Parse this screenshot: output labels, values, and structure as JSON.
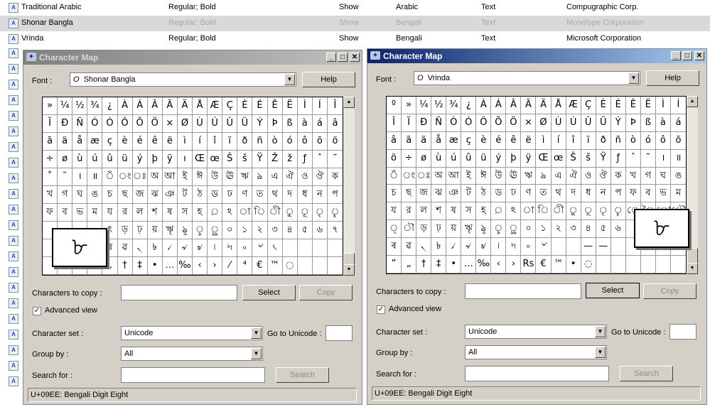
{
  "font_list": {
    "rows": [
      {
        "name": "Traditional Arabic",
        "styles": "Regular; Bold",
        "show": "Show",
        "script": "Arabic",
        "type": "Text",
        "vendor": "Compugraphic Corp."
      },
      {
        "name": "Shonar Bangla",
        "styles": "Regular; Bold",
        "show": "Show",
        "script": "Bengali",
        "type": "Text",
        "vendor": "Monotype Corporation"
      },
      {
        "name": "Vrinda",
        "styles": "Regular; Bold",
        "show": "Show",
        "script": "Bengali",
        "type": "Text",
        "vendor": "Microsoft Corporation"
      }
    ],
    "icon_glyph": "A"
  },
  "left_window": {
    "title": "Character Map",
    "font_label": "Font :",
    "font_value": "Shonar Bangla",
    "font_glyph": "O",
    "help": "Help",
    "chars_label": "Characters to copy :",
    "select": "Select",
    "copy": "Copy",
    "advanced": "Advanced view",
    "charset_label": "Character set :",
    "charset_value": "Unicode",
    "goto_label": "Go to Unicode :",
    "group_label": "Group by :",
    "group_value": "All",
    "search_label": "Search for :",
    "search_btn": "Search",
    "status": "U+09EE: Bengali Digit Eight",
    "zoom_char": "৮",
    "grid": [
      "»",
      "¼",
      "½",
      "¾",
      "¿",
      "À",
      "Á",
      "Â",
      "Ã",
      "Ä",
      "Å",
      "Æ",
      "Ç",
      "È",
      "É",
      "Ê",
      "Ë",
      "Ì",
      "Í",
      "Î",
      "Ï",
      "Ð",
      "Ñ",
      "Ò",
      "Ó",
      "Ô",
      "Õ",
      "Ö",
      "×",
      "Ø",
      "Ù",
      "Ú",
      "Û",
      "Ü",
      "Ý",
      "Þ",
      "ß",
      "à",
      "á",
      "â",
      "ã",
      "ä",
      "å",
      "æ",
      "ç",
      "è",
      "é",
      "ê",
      "ë",
      "ì",
      "í",
      "î",
      "ï",
      "ð",
      "ñ",
      "ò",
      "ó",
      "ô",
      "õ",
      "ö",
      "÷",
      "ø",
      "ù",
      "ú",
      "û",
      "ü",
      "ý",
      "þ",
      "ÿ",
      "ı",
      "Œ",
      "œ",
      "Š",
      "š",
      "Ÿ",
      "Ž",
      "ž",
      "ƒ",
      "ˆ",
      "˜",
      "˚",
      "˜",
      "।",
      "॥",
      "ঁ",
      "ং",
      "ঃ",
      "অ",
      "আ",
      "ই",
      "ঈ",
      "উ",
      "ঊ",
      "ঋ",
      "ঌ",
      "এ",
      "ঐ",
      "ও",
      "ঔ",
      "ক",
      "খ",
      "গ",
      "ঘ",
      "ঙ",
      "চ",
      "ছ",
      "জ",
      "ঝ",
      "ঞ",
      "ট",
      "ঠ",
      "ড",
      "ঢ",
      "ণ",
      "ত",
      "থ",
      "দ",
      "ধ",
      "ন",
      "প",
      "ফ",
      "ব",
      "ভ",
      "ম",
      "য",
      "র",
      "ল",
      "শ",
      "ষ",
      "স",
      "হ",
      "়",
      "ঽ",
      "া",
      "ি",
      "ী",
      "ু",
      "ূ",
      "ৃ",
      "ৄ",
      "",
      "",
      "",
      "",
      "ৎ",
      "ড়",
      "ঢ়",
      "য়",
      "ৠ",
      "ৡ",
      "ৢ",
      "ৣ",
      "০",
      "১",
      "২",
      "৩",
      "৪",
      "৫",
      "৬",
      "৭",
      "",
      "",
      "",
      "",
      "ৰ",
      "ৱ",
      "৲",
      "৳",
      "৴",
      "৵",
      "৶",
      "৷",
      "৸",
      "৹",
      "৺",
      "৻",
      "",
      "",
      "",
      "",
      "",
      "",
      "",
      "”",
      "„",
      "†",
      "‡",
      "•",
      "…",
      "‰",
      "‹",
      "›",
      "⁄",
      "⁴",
      "€",
      "™",
      "◌",
      "",
      "",
      ""
    ]
  },
  "right_window": {
    "title": "Character Map",
    "font_label": "Font :",
    "font_value": "Vrinda",
    "font_glyph": "O",
    "help": "Help",
    "chars_label": "Characters to copy :",
    "select": "Select",
    "copy": "Copy",
    "advanced": "Advanced view",
    "charset_label": "Character set :",
    "charset_value": "Unicode",
    "goto_label": "Go to Unicode :",
    "group_label": "Group by :",
    "group_value": "All",
    "search_label": "Search for :",
    "search_btn": "Search",
    "status": "U+09EE: Bengali Digit Eight",
    "zoom_char": "৮",
    "grid": [
      "º",
      "»",
      "¼",
      "½",
      "¾",
      "¿",
      "À",
      "Á",
      "Â",
      "Ã",
      "Ä",
      "Å",
      "Æ",
      "Ç",
      "È",
      "É",
      "Ê",
      "Ë",
      "Ì",
      "Í",
      "Î",
      "Ï",
      "Ð",
      "Ñ",
      "Ò",
      "Ó",
      "Ô",
      "Õ",
      "Ö",
      "×",
      "Ø",
      "Ù",
      "Ú",
      "Û",
      "Ü",
      "Ý",
      "Þ",
      "ß",
      "à",
      "á",
      "â",
      "ã",
      "ä",
      "å",
      "æ",
      "ç",
      "è",
      "é",
      "ê",
      "ë",
      "ì",
      "í",
      "î",
      "ï",
      "ð",
      "ñ",
      "ò",
      "ó",
      "ô",
      "õ",
      "ö",
      "÷",
      "ø",
      "ù",
      "ú",
      "û",
      "ü",
      "ý",
      "þ",
      "ÿ",
      "Œ",
      "œ",
      "Š",
      "š",
      "Ÿ",
      "ƒ",
      "ˆ",
      "˜",
      "।",
      "॥",
      "ঁ",
      "ং",
      "ঃ",
      "অ",
      "আ",
      "ই",
      "ঈ",
      "উ",
      "ঊ",
      "ঋ",
      "ঌ",
      "এ",
      "ঐ",
      "ও",
      "ঔ",
      "ক",
      "খ",
      "গ",
      "ঘ",
      "ঙ",
      "চ",
      "ছ",
      "জ",
      "ঝ",
      "ঞ",
      "ট",
      "ঠ",
      "ড",
      "ঢ",
      "ণ",
      "ত",
      "থ",
      "দ",
      "ধ",
      "ন",
      "প",
      "ফ",
      "ব",
      "ভ",
      "ম",
      "য",
      "র",
      "ল",
      "শ",
      "ষ",
      "স",
      "হ",
      "়",
      "ঽ",
      "া",
      "ি",
      "ী",
      "ু",
      "ূ",
      "ৃ",
      "ৄ",
      "ে",
      "ৈ",
      "ো",
      "ৌ",
      "্",
      "ৗ",
      "ড়",
      "ঢ়",
      "য়",
      "ৠ",
      "ৡ",
      "ৢ",
      "ৣ",
      "০",
      "১",
      "২",
      "৩",
      "৪",
      "৫",
      "৬",
      "",
      "",
      "",
      "",
      "ৰ",
      "ৱ",
      "৲",
      "৳",
      "৴",
      "৵",
      "৶",
      "৷",
      "৸",
      "৹",
      "৺",
      "",
      "",
      "—",
      "—",
      "",
      "",
      "",
      "",
      "",
      "”",
      "„",
      "†",
      "‡",
      "•",
      "…",
      "‰",
      "‹",
      "›",
      "Rs",
      "€",
      "™",
      "•",
      "◌",
      "",
      "",
      "",
      "",
      "",
      ""
    ]
  }
}
